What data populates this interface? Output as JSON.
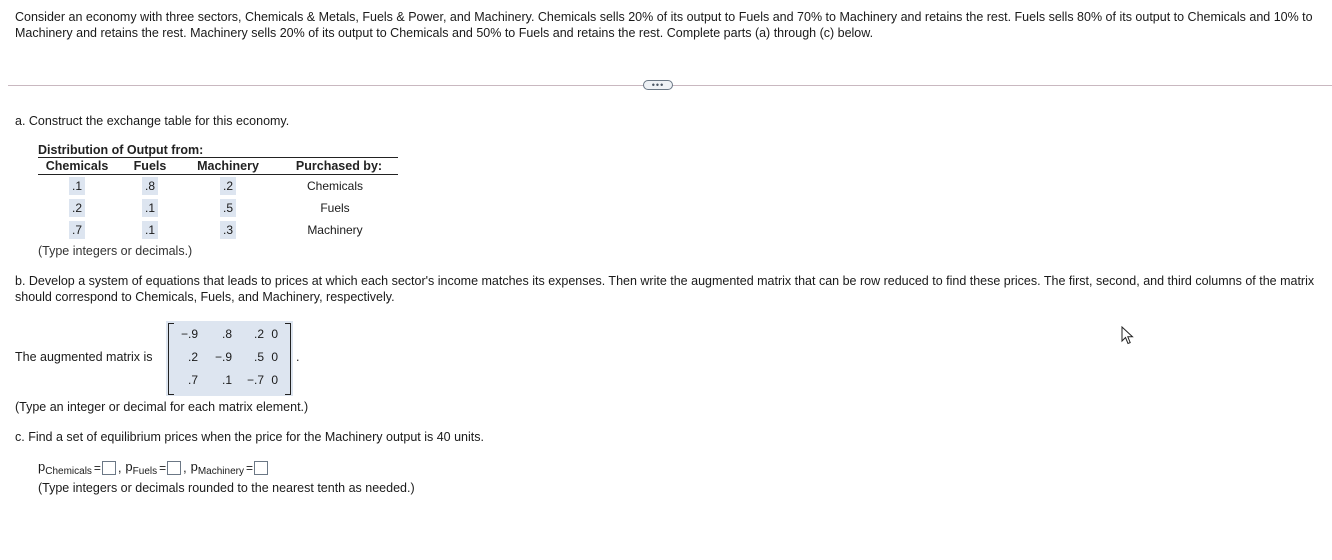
{
  "problem_text": "Consider an economy with three sectors, Chemicals & Metals, Fuels & Power, and Machinery. Chemicals sells 20% of its output to Fuels and 70% to Machinery and retains the rest. Fuels sells 80% of its output to Chemicals and 10% to Machinery and retains the rest. Machinery sells 20% of its output to Chemicals and 50% to Fuels and retains the rest. Complete parts (a) through (c) below.",
  "more_button": "•••",
  "part_a": {
    "prompt": "a. Construct the exchange table for this economy.",
    "table_title": "Distribution of Output from:",
    "headers": [
      "Chemicals",
      "Fuels",
      "Machinery",
      "Purchased by:"
    ],
    "rows": [
      {
        "values": [
          ".1",
          ".8",
          ".2"
        ],
        "purchased_by": "Chemicals"
      },
      {
        "values": [
          ".2",
          ".1",
          ".5"
        ],
        "purchased_by": "Fuels"
      },
      {
        "values": [
          ".7",
          ".1",
          ".3"
        ],
        "purchased_by": "Machinery"
      }
    ],
    "hint": "(Type integers or decimals.)"
  },
  "part_b": {
    "prompt": "b. Develop a system of equations that leads to prices at which each sector's income matches its expenses. Then write the augmented matrix that can be row reduced to find these prices. The first, second, and third columns of the matrix should correspond to Chemicals, Fuels, and Machinery, respectively.",
    "matrix_label": "The augmented matrix is",
    "matrix": [
      [
        "−.9",
        ".8",
        ".2",
        "0"
      ],
      [
        ".2",
        "−.9",
        ".5",
        "0"
      ],
      [
        ".7",
        ".1",
        "−.7",
        "0"
      ]
    ],
    "period": ".",
    "hint": "(Type an integer or decimal for each matrix element.)"
  },
  "part_c": {
    "prompt": "c. Find a set of equilibrium prices when the price for the Machinery output is 40 units.",
    "prices": [
      {
        "var": "p",
        "sub": "Chemicals",
        "value": ""
      },
      {
        "var": "p",
        "sub": "Fuels",
        "value": ""
      },
      {
        "var": "p",
        "sub": "Machinery",
        "value": ""
      }
    ],
    "equals": "=",
    "comma": ",",
    "hint": "(Type integers or decimals rounded to the nearest tenth as needed.)"
  }
}
